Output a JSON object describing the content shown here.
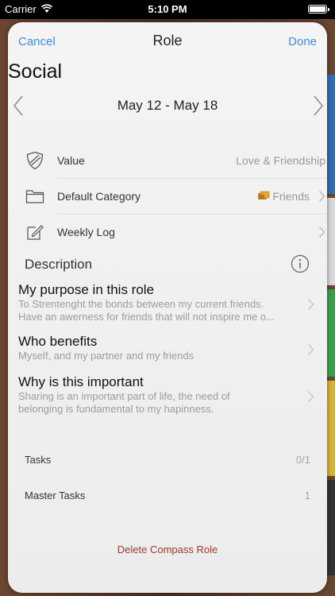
{
  "status_bar": {
    "carrier": "Carrier",
    "time": "5:10 PM",
    "wifi_icon": "wifi-icon",
    "battery_icon": "battery-icon"
  },
  "nav": {
    "cancel_label": "Cancel",
    "title": "Role",
    "done_label": "Done"
  },
  "role": {
    "name": "Social"
  },
  "week": {
    "range": "May 12 - May 18",
    "prev_icon": "chevron-left-icon",
    "next_icon": "chevron-right-icon"
  },
  "settings": [
    {
      "label": "Value",
      "value": "Love & Friendship",
      "icon": "shield-icon"
    },
    {
      "label": "Default Category",
      "value": "Friends",
      "icon": "folder-icon",
      "badge_icon": "folder-badge-icon"
    },
    {
      "label": "Weekly Log",
      "value": "",
      "icon": "edit-icon"
    }
  ],
  "description": {
    "header": "Description",
    "info_icon": "info-icon",
    "items": [
      {
        "title": "My purpose in this role",
        "text": "To Strentenght the bonds between my current friends.\nHave an awerness for friends that will not inspire me o..."
      },
      {
        "title": "Who benefits",
        "text": "Myself, and my partner and my friends"
      },
      {
        "title": "Why is this important",
        "text": "Sharing is an important part of life, the need of\nbelonging is fundamental to my hapinness."
      }
    ]
  },
  "stats": [
    {
      "label": "Tasks",
      "value": "0/1"
    },
    {
      "label": "Master Tasks",
      "value": "1"
    }
  ],
  "delete_label": "Delete Compass Role",
  "colors": {
    "accent": "#3e8dd6",
    "destructive": "#9b3a2f",
    "wood": "#5a3a26"
  }
}
